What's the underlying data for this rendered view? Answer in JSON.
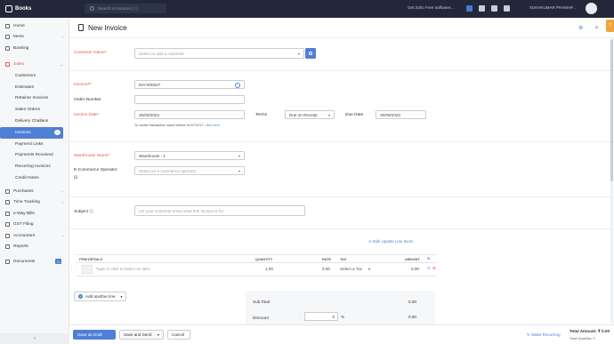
{
  "topbar": {
    "app_name": "Books",
    "search_placeholder": "Search in Invoices ( / )",
    "promo": "Get Zoho Free Software...",
    "user_name": "SUKHKUMAR PHAMAP..."
  },
  "sidebar": {
    "home": "Home",
    "items": "Items",
    "banking": "Banking",
    "sales": "Sales",
    "customers": "Customers",
    "estimates": "Estimates",
    "retainer_invoices": "Retainer Invoices",
    "sales_orders": "Sales Orders",
    "delivery_challans": "Delivery Challans",
    "invoices": "Invoices",
    "payments_links": "Payment Links",
    "payments_received": "Payments Received",
    "recurring_invoices": "Recurring Invoices",
    "credit_notes": "Credit Notes",
    "purchases": "Purchases",
    "time_tracking": "Time Tracking",
    "eway_bills": "e-Way Bills",
    "gst_filing": "GST Filing",
    "accountant": "Accountant",
    "reports": "Reports",
    "documents": "Documents",
    "documents_badge": "0"
  },
  "page": {
    "title": "New Invoice"
  },
  "form": {
    "customer_label": "Customer Name*",
    "customer_placeholder": "Select or add a customer",
    "invoice_label": "Invoice#*",
    "invoice_value": "INV-000037",
    "order_label": "Order Number",
    "invoice_date_label": "Invoice Date*",
    "invoice_date_value": "25/08/2023",
    "terms_label": "Terms",
    "terms_value": "Due on Receipt",
    "due_date_label": "Due Date",
    "due_date_value": "25/08/2023",
    "note_text": "To create transaction dated before 01/07/2017,",
    "note_link": "click here",
    "warehouse_label": "Warehouse Name*",
    "warehouse_value": "Warehouse - 1",
    "ecommerce_label": "E-Commerce Operator",
    "ecommerce_placeholder": "Select an e-commerce operator",
    "subject_label": "Subject",
    "subject_placeholder": "Let your customer know what this Invoice is for"
  },
  "items_table": {
    "bulk_update": "Bulk Update Line Items",
    "headers": [
      "ITEM DETAILS",
      "QUANTITY",
      "RATE",
      "TAX",
      "AMOUNT"
    ],
    "row": {
      "item_placeholder": "Type or click to select an item.",
      "quantity": "1.00",
      "rate": "0.00",
      "tax": "Select a Tax",
      "amount": "0.00"
    },
    "add_line": "Add another line"
  },
  "totals": {
    "subtotal_label": "Sub Total",
    "subtotal_value": "0.00",
    "discount_label": "Discount",
    "discount_value": "0",
    "discount_unit": "%",
    "discount_amount": "0.00"
  },
  "footer": {
    "save_draft": "Save as Draft",
    "save_send": "Save and Send",
    "cancel": "Cancel",
    "make_recurring": "Make Recurring",
    "total_amount": "Total Amount: ₹ 0.00",
    "total_quantity": "Total Quantity: 1"
  }
}
